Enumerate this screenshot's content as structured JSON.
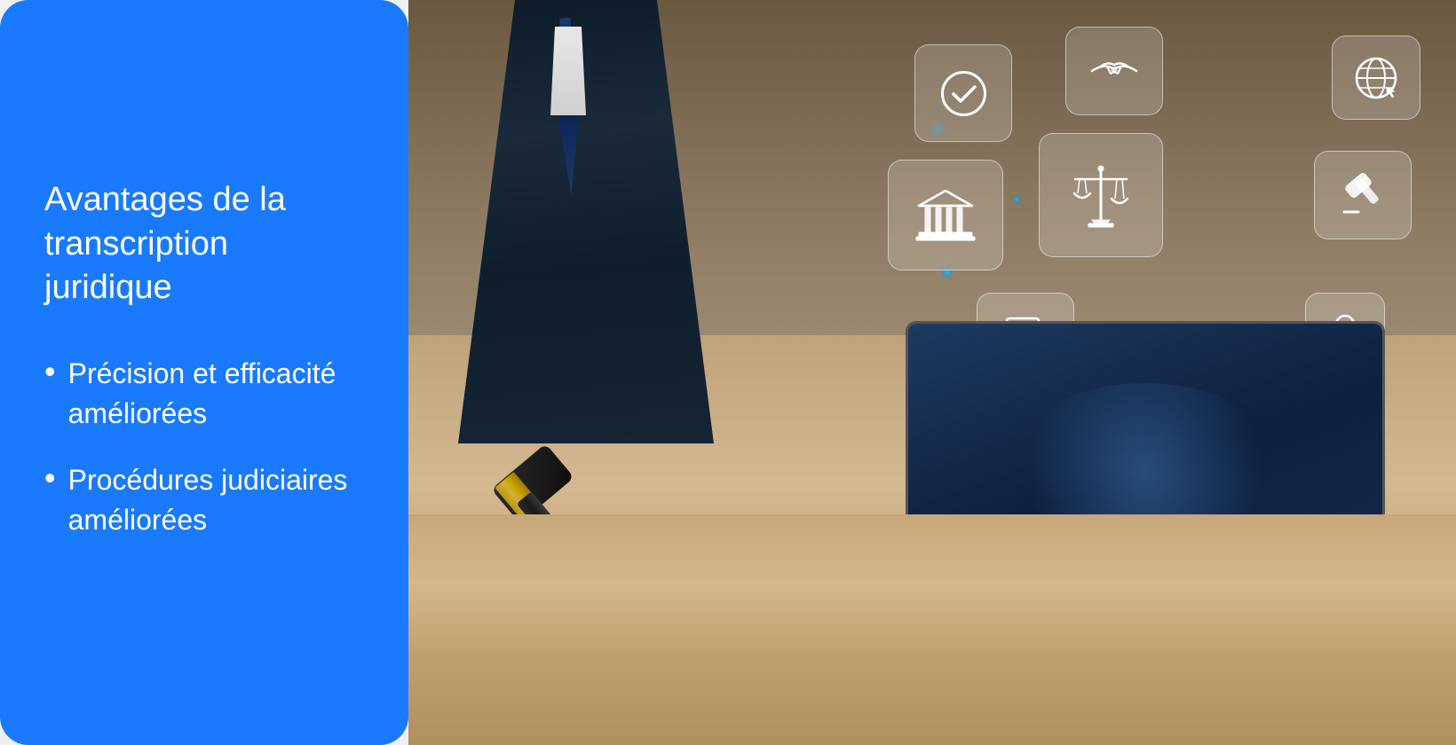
{
  "left_panel": {
    "background_color": "#1a7aff",
    "title": "Avantages de la transcription juridique",
    "bullets": [
      {
        "id": "bullet-1",
        "text": "Précision et efficacité améliorées"
      },
      {
        "id": "bullet-2",
        "text": "Procédures judiciaires améliorées"
      }
    ],
    "bullet_symbol": "•"
  },
  "right_panel": {
    "description": "Legal professional using laptop with floating legal icons",
    "icons": [
      {
        "id": "checkmark",
        "label": "checkmark-circle-icon"
      },
      {
        "id": "handshake",
        "label": "handshake-icon"
      },
      {
        "id": "globe",
        "label": "globe-icon"
      },
      {
        "id": "building",
        "label": "court-building-icon"
      },
      {
        "id": "scales",
        "label": "justice-scales-icon"
      },
      {
        "id": "gavel",
        "label": "gavel-icon"
      },
      {
        "id": "law-doc",
        "label": "law-document-icon"
      },
      {
        "id": "person",
        "label": "person-icon"
      }
    ]
  }
}
